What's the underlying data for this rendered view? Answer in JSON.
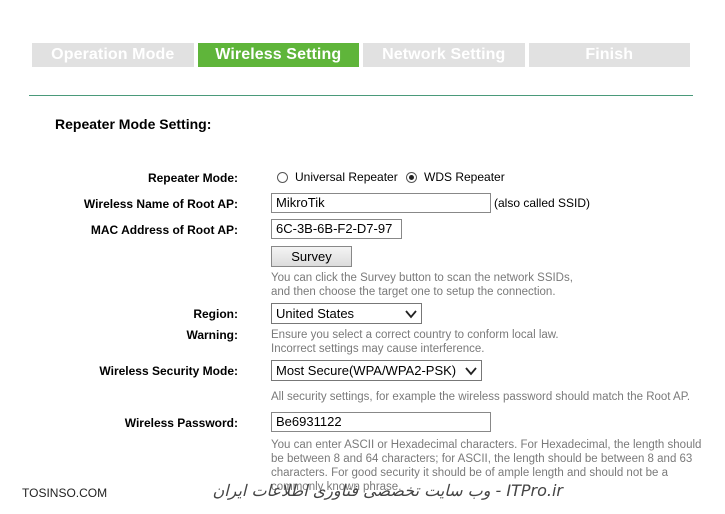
{
  "steps": [
    {
      "label": "Operation Mode",
      "active": false
    },
    {
      "label": "Wireless Setting",
      "active": true
    },
    {
      "label": "Network Setting",
      "active": false
    },
    {
      "label": "Finish",
      "active": false
    }
  ],
  "section_title": "Repeater Mode Setting:",
  "repeater_mode": {
    "label": "Repeater Mode:",
    "options": [
      "Universal Repeater",
      "WDS Repeater"
    ],
    "selected": "WDS Repeater"
  },
  "root_ap_name": {
    "label": "Wireless Name of Root AP:",
    "value": "MikroTik",
    "note": "(also called SSID)"
  },
  "root_ap_mac": {
    "label": "MAC Address of Root AP:",
    "value": "6C-3B-6B-F2-D7-97"
  },
  "survey": {
    "button": "Survey",
    "hint_line1": "You can click the Survey button to scan the network SSIDs,",
    "hint_line2": "and then choose the target one to setup the connection."
  },
  "region": {
    "label": "Region:",
    "value": "United States"
  },
  "warning": {
    "label": "Warning:",
    "line1": "Ensure you select a correct country to conform local law.",
    "line2": "Incorrect settings may cause interference."
  },
  "security_mode": {
    "label": "Wireless Security Mode:",
    "value": "Most Secure(WPA/WPA2-PSK)",
    "hint": "All security settings, for example the wireless password should match the Root AP."
  },
  "password": {
    "label": "Wireless Password:",
    "value": "Be6931122",
    "hint_line1": "You can enter ASCII or Hexadecimal characters. For Hexadecimal, the length should",
    "hint_line2": "be between 8 and 64 characters; for ASCII, the length should be between 8 and 63",
    "hint_line3": "characters. For good security it should be of ample length and should not be a",
    "hint_line4": "commonly known phrase."
  },
  "watermark": {
    "left": "TOSINSO.COM",
    "right": "ITPro.ir - وب سایت تخصصی فناوری اطلاعات ایران"
  }
}
